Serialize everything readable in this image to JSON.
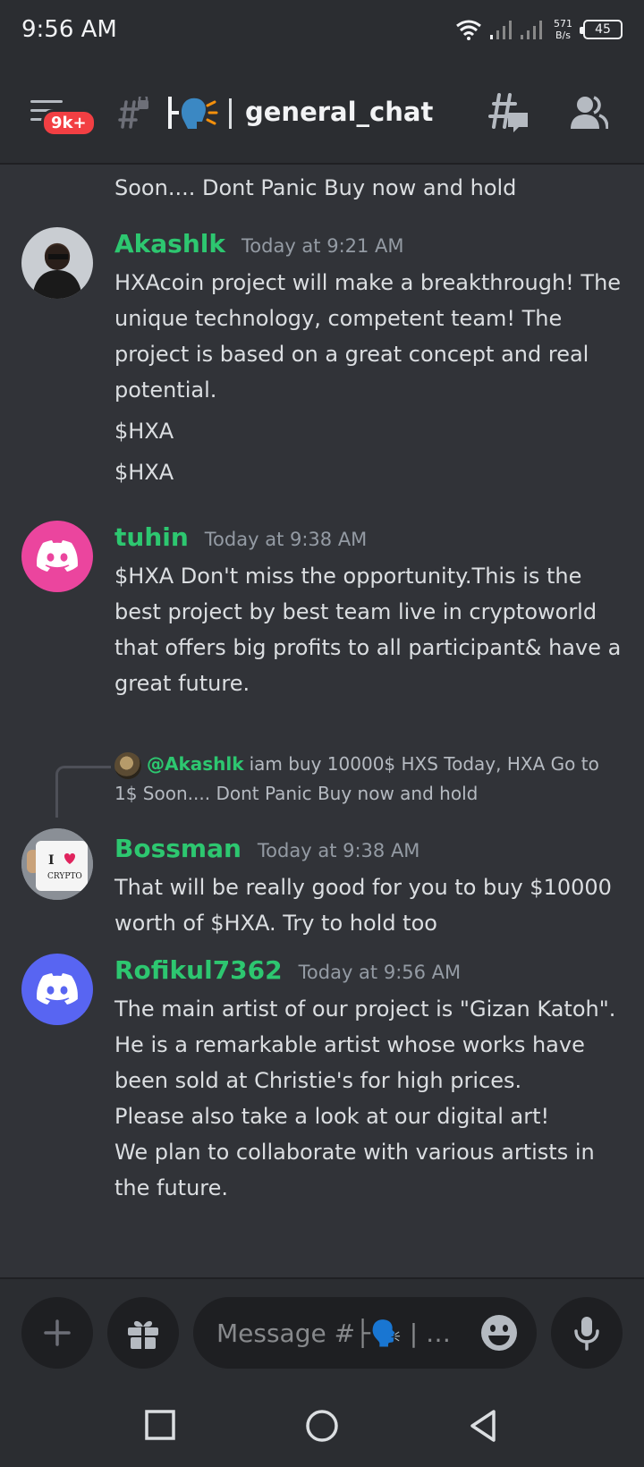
{
  "status_bar": {
    "time": "9:56 AM",
    "net_speed_value": "571",
    "net_speed_unit": "B/s",
    "battery": "45"
  },
  "header": {
    "badge": "9k+",
    "channel_emoji": "├🗣️",
    "channel_name": "general_chat"
  },
  "partial_message": "Soon.... Dont Panic Buy now and hold",
  "messages": [
    {
      "author": "Akashlk",
      "timestamp": "Today at 9:21 AM",
      "lines": [
        "HXAcoin project will make a breakthrough! The unique technology, competent team! The project is based on a great concept and real potential.",
        "$HXA",
        "$HXA"
      ]
    },
    {
      "author": "tuhin",
      "timestamp": "Today at 9:38 AM",
      "lines": [
        "$HXA Don't miss the opportunity.This is the best project by best team live in cryptoworld that offers big profits to all participant& have a great future."
      ]
    },
    {
      "reply": {
        "mention": "@Akashlk",
        "text": "iam buy 10000$ HXS Today, HXA Go to 1$ Soon.... Dont Panic Buy now and hold"
      },
      "author": "Bossman",
      "timestamp": "Today at 9:38 AM",
      "avatar_text": "CRYPTO",
      "lines": [
        "That will be really good for you to buy $10000 worth of $HXA. Try to hold too"
      ]
    },
    {
      "author": "Rofikul7362",
      "timestamp": "Today at 9:56 AM",
      "lines": [
        "The main artist of our project is \"Gizan Katoh\". He is a remarkable artist whose works have been sold at Christie's for high prices.",
        "Please also take a look at our digital art!",
        "We plan to collaborate with various artists in the future."
      ]
    }
  ],
  "composer": {
    "placeholder": "Message #├🗣️ | …"
  },
  "icons": {
    "menu": "hamburger-icon",
    "thread": "locked-thread-icon",
    "threads": "threads-icon",
    "members": "members-icon",
    "add": "plus-icon",
    "gift": "gift-icon",
    "emoji": "emoji-icon",
    "mic": "microphone-icon"
  },
  "colors": {
    "background": "#313338",
    "header": "#2b2d31",
    "author": "#2dc770",
    "badge": "#f23f43",
    "discord_pink": "#eb459e",
    "discord_blurple": "#5865f2"
  }
}
